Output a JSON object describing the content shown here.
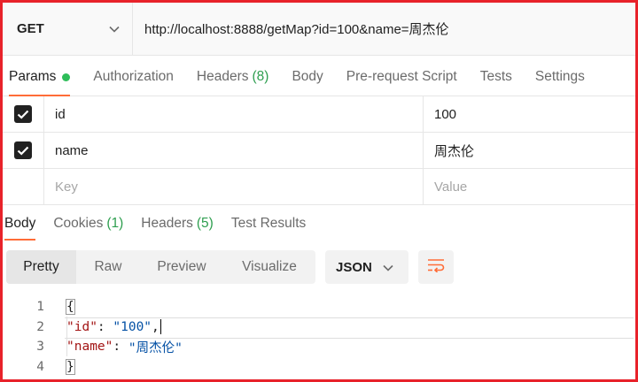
{
  "request": {
    "method": "GET",
    "url": "http://localhost:8888/getMap?id=100&name=周杰伦"
  },
  "request_tabs": [
    {
      "label": "Params",
      "active": true,
      "dot": true
    },
    {
      "label": "Authorization"
    },
    {
      "label": "Headers",
      "count": "(8)"
    },
    {
      "label": "Body"
    },
    {
      "label": "Pre-request Script"
    },
    {
      "label": "Tests"
    },
    {
      "label": "Settings"
    }
  ],
  "params": {
    "rows": [
      {
        "checked": true,
        "key": "id",
        "value": "100"
      },
      {
        "checked": true,
        "key": "name",
        "value": "周杰伦"
      }
    ],
    "key_placeholder": "Key",
    "value_placeholder": "Value"
  },
  "response_tabs": [
    {
      "label": "Body",
      "active": true
    },
    {
      "label": "Cookies",
      "count": "(1)"
    },
    {
      "label": "Headers",
      "count": "(5)"
    },
    {
      "label": "Test Results"
    }
  ],
  "format": {
    "modes": [
      "Pretty",
      "Raw",
      "Preview",
      "Visualize"
    ],
    "active_mode": "Pretty",
    "language": "JSON",
    "wrap_icon": "wrap-lines-icon"
  },
  "code": {
    "line_numbers": [
      "1",
      "2",
      "3",
      "4"
    ],
    "open_brace": "{",
    "close_brace": "}",
    "key1": "\"id\"",
    "colon1": ": ",
    "val1": "\"100\"",
    "comma1": ",",
    "key2": "\"name\"",
    "colon2": ": ",
    "val2": "\"周杰伦\""
  },
  "colors": {
    "accent": "#ff6c37",
    "status_green": "#2ebd59",
    "frame_red": "#e8222a"
  }
}
